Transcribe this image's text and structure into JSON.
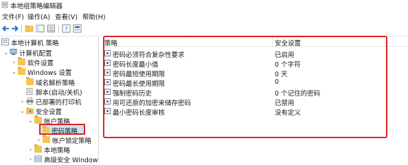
{
  "window": {
    "title": "本地组策略编辑器"
  },
  "menu": [
    "文件(F)",
    "操作(A)",
    "查看(V)",
    "帮助(H)"
  ],
  "toolbar": {
    "buttons": [
      "back-icon",
      "forward-icon",
      "folder-up-icon",
      "show-tree-icon",
      "export-list-icon",
      "help-icon",
      "properties-icon"
    ]
  },
  "tree": {
    "root": "本地计算机 策略",
    "computer_config": "计算机配置",
    "software_settings": "软件设置",
    "windows_settings": "Windows 设置",
    "name_resolution": "域名解析策略",
    "scripts": "脚本(启动/关机)",
    "printers": "已部署的打印机",
    "security_settings": "安全设置",
    "account_policies": "帐户策略",
    "password_policy": "密码策略",
    "lockout_policy": "帐户锁定策略",
    "local_policies": "本地策略",
    "advanced_firewall": "高级安全 Windows"
  },
  "list": {
    "columns": [
      "策略",
      "安全设置"
    ],
    "rows": [
      {
        "policy": "密码必须符合复杂性要求",
        "setting": "已启用"
      },
      {
        "policy": "密码长度最小值",
        "setting": "0 个字符"
      },
      {
        "policy": "密码最短使用期限",
        "setting": "0 天"
      },
      {
        "policy": "密码最长使用期限",
        "setting": "0"
      },
      {
        "policy": "强制密码历史",
        "setting": "0 个记住的密码"
      },
      {
        "policy": "用可还原的加密来储存密码",
        "setting": "已禁用"
      },
      {
        "policy": "最小密码长度审核",
        "setting": "没有定义"
      }
    ]
  },
  "colors": {
    "highlight": "#e02020",
    "selection": "#cce4f7",
    "folder": "#f3c553"
  }
}
